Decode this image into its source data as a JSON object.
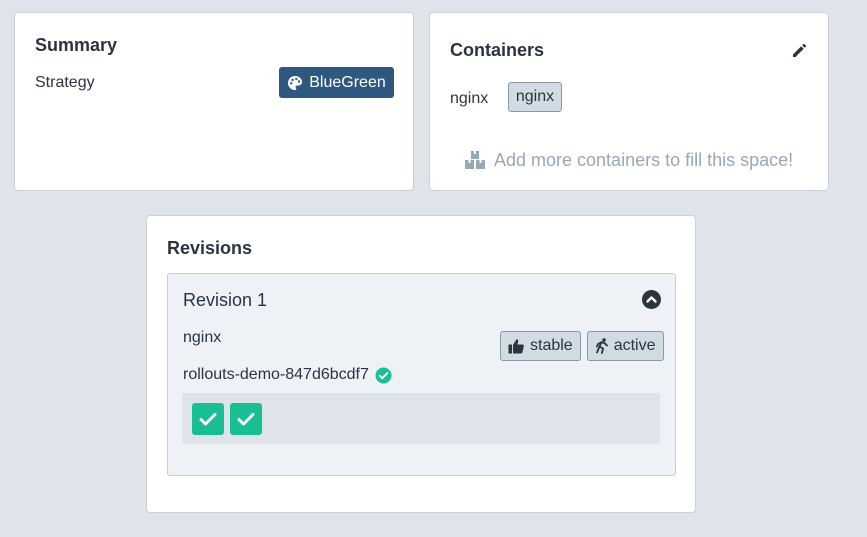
{
  "summary": {
    "title": "Summary",
    "strategy_label": "Strategy",
    "strategy_value": "BlueGreen",
    "strategy_icon": "palette-icon",
    "badge_color": "#2f5880"
  },
  "containers": {
    "title": "Containers",
    "edit_icon": "pencil-icon",
    "items": [
      {
        "name": "nginx",
        "image": "nginx"
      }
    ],
    "add_hint": "Add more containers to fill this space!",
    "add_hint_icon": "boxes-icon"
  },
  "revisions": {
    "title": "Revisions",
    "items": [
      {
        "title": "Revision 1",
        "image": "nginx",
        "tags": [
          {
            "label": "stable",
            "icon": "thumbs-up-icon"
          },
          {
            "label": "active",
            "icon": "running-icon"
          }
        ],
        "replicaset": "rollouts-demo-847d6bcdf7",
        "replicaset_status": "healthy",
        "pods": [
          {
            "status": "healthy"
          },
          {
            "status": "healthy"
          }
        ]
      }
    ]
  },
  "colors": {
    "background": "#dee4ea",
    "healthy": "#18be94",
    "tag_bg": "#d1dbe3",
    "hint_text": "#98a8b6"
  }
}
